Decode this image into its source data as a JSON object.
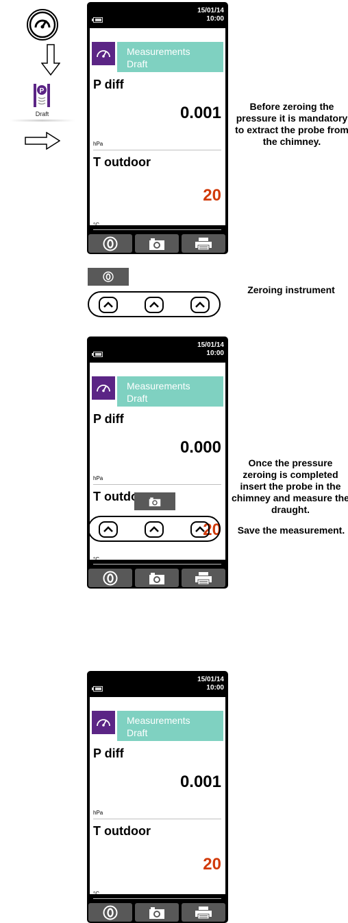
{
  "navigation": {
    "menu_item_label": "Draft",
    "icon_names": [
      "gauge-icon",
      "arrow-down-icon",
      "draft-pressure-icon",
      "arrow-right-icon"
    ]
  },
  "device_screens": [
    {
      "date": "15/01/14",
      "time": "10:00",
      "header": {
        "line1": "Measurements",
        "line2": "Draft"
      },
      "measurements": [
        {
          "label": "P diff",
          "value": "0.001",
          "unit": "hPa"
        },
        {
          "label": "T outdoor",
          "value": "20",
          "unit": "°C"
        }
      ]
    },
    {
      "date": "15/01/14",
      "time": "10:00",
      "header": {
        "line1": "Measurements",
        "line2": "Draft"
      },
      "measurements": [
        {
          "label": "P diff",
          "value": "0.000",
          "unit": "hPa"
        },
        {
          "label": "T outdoor",
          "value": "20",
          "unit": "°C"
        }
      ]
    },
    {
      "date": "15/01/14",
      "time": "10:00",
      "header": {
        "line1": "Measurements",
        "line2": "Draft"
      },
      "measurements": [
        {
          "label": "P diff",
          "value": "0.001",
          "unit": "hPa"
        },
        {
          "label": "T outdoor",
          "value": "20",
          "unit": "°C"
        }
      ]
    }
  ],
  "softkeys": [
    "zero-icon",
    "camera-icon",
    "printer-icon"
  ],
  "key_steps": [
    {
      "active_key": "zero-icon"
    },
    {
      "active_key": "camera-icon"
    }
  ],
  "captions": {
    "step1": "Before zeroing the pressure it is mandatory to extract the probe from the chimney.",
    "step2": "Zeroing instrument",
    "step3": "Once the pressure zeroing is completed insert the probe in the chimney and measure the draught.",
    "step4": "Save the measurement."
  },
  "colors": {
    "header_teal": "#7fd1c1",
    "icon_purple": "#5b2585",
    "temperature_value": "#d13a0a",
    "softkey_gray": "#585858"
  }
}
